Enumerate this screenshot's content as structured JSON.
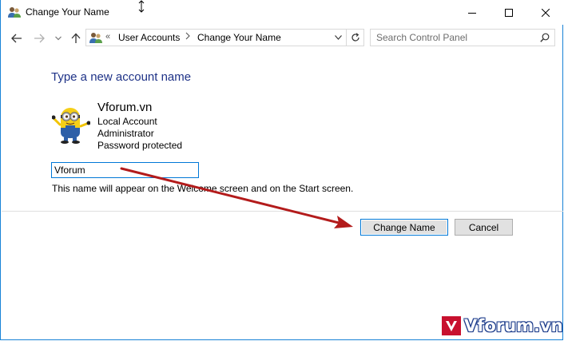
{
  "window": {
    "title": "Change Your Name"
  },
  "address_bar": {
    "overflow": "«",
    "breadcrumbs": [
      "User Accounts",
      "Change Your Name"
    ]
  },
  "search": {
    "placeholder": "Search Control Panel"
  },
  "content": {
    "heading": "Type a new account name",
    "account": {
      "name": "Vforum.vn",
      "type": "Local Account",
      "role": "Administrator",
      "security": "Password protected"
    },
    "name_field_value": "Vforum",
    "hint": "This name will appear on the Welcome screen and on the Start screen."
  },
  "buttons": {
    "change_name": "Change Name",
    "cancel": "Cancel"
  },
  "watermark": {
    "text": "Vforum.vn"
  },
  "colors": {
    "heading": "#1e3287",
    "accent": "#0078d7",
    "arrow": "#b31b1b"
  },
  "icons": [
    "users-icon",
    "back-arrow-icon",
    "forward-arrow-icon",
    "recent-dropdown-icon",
    "up-arrow-icon",
    "control-panel-icon",
    "chevron-right-icon",
    "chevron-down-icon",
    "refresh-icon",
    "search-icon",
    "minimize-icon",
    "maximize-icon",
    "close-icon",
    "minion-avatar",
    "annotation-arrow"
  ]
}
